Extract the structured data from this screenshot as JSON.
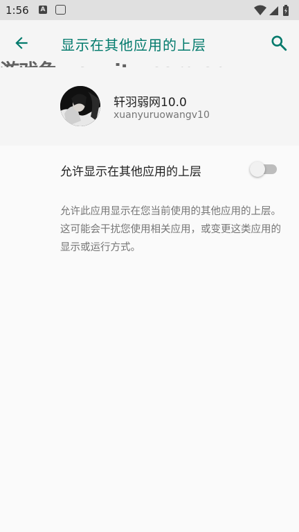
{
  "status_bar": {
    "time": "1:56"
  },
  "app_bar": {
    "title": "显示在其他应用的上层"
  },
  "watermark": {
    "text": "游戏兔 youxitu.com.cn"
  },
  "app_info": {
    "name": "轩羽弱网10.0",
    "package": "xuanyuruowangv10"
  },
  "preference": {
    "title": "允许显示在其他应用的上层",
    "enabled": false,
    "summary": "允许此应用显示在您当前使用的其他应用的上层。这可能会干扰您使用相关应用，或变更这类应用的显示或运行方式。"
  },
  "colors": {
    "accent": "#00796b",
    "background": "#fafafa",
    "header": "#f5f5f5"
  }
}
